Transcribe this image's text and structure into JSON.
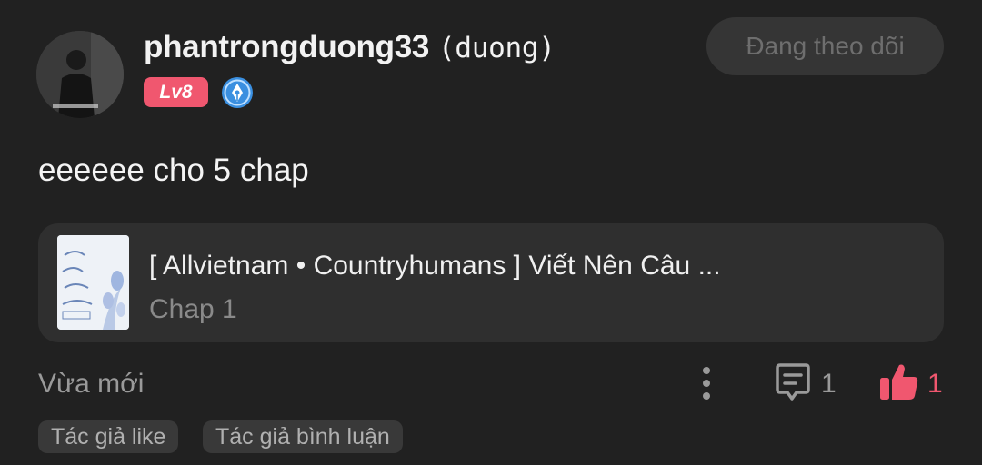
{
  "user": {
    "username": "phantrongduong33",
    "nickname": "(duong)",
    "level": "Lv8",
    "avatar_icon": "avatar-photo",
    "badge_icon": "pen-nib-badge-icon"
  },
  "follow_button": {
    "label": "Đang theo dõi"
  },
  "comment": {
    "text": "eeeeee cho 5 chap"
  },
  "story": {
    "title": "[ Allvietnam • Countryhumans ] Viết Nên Câu ...",
    "chapter": "Chap 1"
  },
  "footer": {
    "timestamp": "Vừa mới",
    "comment_count": "1",
    "like_count": "1"
  },
  "tags": [
    "Tác giả like",
    "Tác giả bình luận"
  ],
  "colors": {
    "background": "#212121",
    "card": "#2f2f2f",
    "accent_pink": "#f0576f",
    "badge_blue": "#3a8fe0"
  }
}
